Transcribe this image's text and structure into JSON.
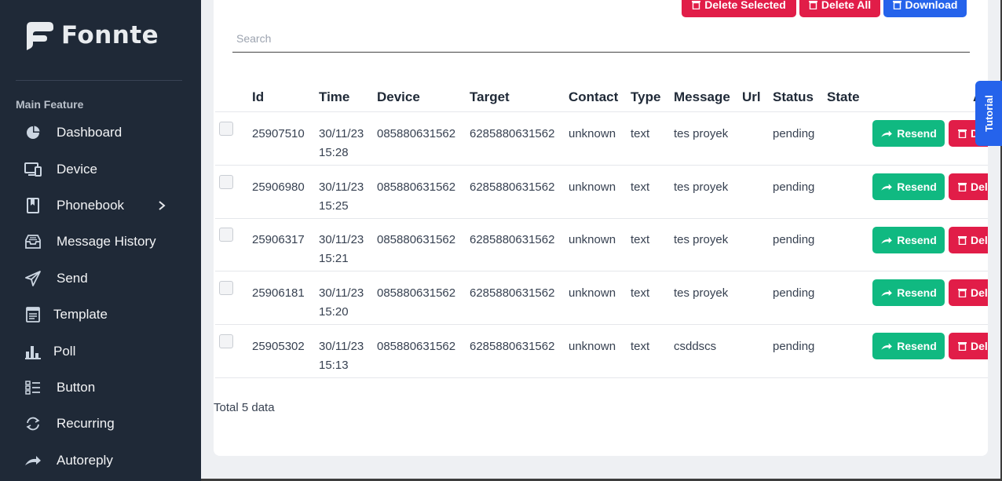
{
  "brand": {
    "name": "Fonnte"
  },
  "sidebar": {
    "section_title": "Main Feature",
    "items": [
      {
        "label": "Dashboard",
        "icon": "pie-chart-icon"
      },
      {
        "label": "Device",
        "icon": "devices-icon"
      },
      {
        "label": "Phonebook",
        "icon": "book-icon",
        "has_submenu": true
      },
      {
        "label": "Message History",
        "icon": "inbox-icon"
      },
      {
        "label": "Send",
        "icon": "paper-plane-icon"
      },
      {
        "label": "Template",
        "icon": "template-icon"
      },
      {
        "label": "Poll",
        "icon": "bar-chart-icon"
      },
      {
        "label": "Button",
        "icon": "list-icon"
      },
      {
        "label": "Recurring",
        "icon": "refresh-icon"
      },
      {
        "label": "Autoreply",
        "icon": "forward-icon"
      }
    ]
  },
  "toolbar": {
    "delete_selected": "Delete Selected",
    "delete_all": "Delete All",
    "download": "Download"
  },
  "search": {
    "placeholder": "Search",
    "value": ""
  },
  "table": {
    "columns": [
      "Id",
      "Time",
      "Device",
      "Target",
      "Contact",
      "Type",
      "Message",
      "Url",
      "Status",
      "State",
      "A"
    ],
    "rows": [
      {
        "id": "25907510",
        "date": "30/11/23",
        "time": "15:28",
        "device": "085880631562",
        "target": "6285880631562",
        "contact": "unknown",
        "type": "text",
        "message": "tes proyek",
        "url": "",
        "status": "pending",
        "state": ""
      },
      {
        "id": "25906980",
        "date": "30/11/23",
        "time": "15:25",
        "device": "085880631562",
        "target": "6285880631562",
        "contact": "unknown",
        "type": "text",
        "message": "tes proyek",
        "url": "",
        "status": "pending",
        "state": ""
      },
      {
        "id": "25906317",
        "date": "30/11/23",
        "time": "15:21",
        "device": "085880631562",
        "target": "6285880631562",
        "contact": "unknown",
        "type": "text",
        "message": "tes proyek",
        "url": "",
        "status": "pending",
        "state": ""
      },
      {
        "id": "25906181",
        "date": "30/11/23",
        "time": "15:20",
        "device": "085880631562",
        "target": "6285880631562",
        "contact": "unknown",
        "type": "text",
        "message": "tes proyek",
        "url": "",
        "status": "pending",
        "state": ""
      },
      {
        "id": "25905302",
        "date": "30/11/23",
        "time": "15:13",
        "device": "085880631562",
        "target": "6285880631562",
        "contact": "unknown",
        "type": "text",
        "message": "csddscs",
        "url": "",
        "status": "pending",
        "state": ""
      }
    ],
    "resend_label": "Resend",
    "delete_label": "Delete"
  },
  "footer": {
    "total": "Total 5 data"
  },
  "tutorial": {
    "label": "Tutorial"
  },
  "colors": {
    "sidebar": "#1f2937",
    "danger": "#e11d48",
    "primary": "#2563eb",
    "success": "#10b981"
  }
}
